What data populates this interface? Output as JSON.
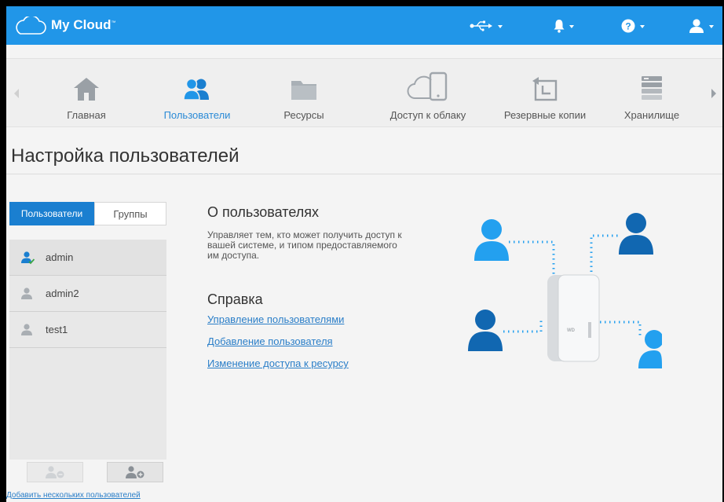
{
  "app": {
    "title": "My Cloud",
    "trademark": "™"
  },
  "colors": {
    "topbar": "#2196e8",
    "accent": "#1a7fd0",
    "link": "#2a7ec8",
    "person_dark": "#1167b1",
    "person_light": "#23a0ef"
  },
  "topbar": {
    "icons": [
      "usb-icon",
      "bell-icon",
      "help-icon",
      "user-icon"
    ]
  },
  "nav": {
    "items": [
      {
        "label": "Главная",
        "icon": "home-icon"
      },
      {
        "label": "Пользователи",
        "icon": "users-icon",
        "active": true
      },
      {
        "label": "Ресурсы",
        "icon": "folder-icon"
      },
      {
        "label": "Доступ к облаку",
        "icon": "cloud-mobile-icon"
      },
      {
        "label": "Резервные копии",
        "icon": "backup-icon"
      },
      {
        "label": "Хранилище",
        "icon": "storage-icon"
      }
    ]
  },
  "page": {
    "title": "Настройка пользователей"
  },
  "left": {
    "tabs": {
      "users": "Пользователи",
      "groups": "Группы"
    },
    "users": [
      {
        "name": "admin",
        "admin": true
      },
      {
        "name": "admin2"
      },
      {
        "name": "test1"
      }
    ],
    "add_multiple": "Добавить нескольких пользователей"
  },
  "main": {
    "about_title": "О пользователях",
    "about_text": "Управляет тем, кто может получить доступ к вашей системе, и типом предоставляемого им доступа.",
    "help_title": "Справка",
    "links": [
      "Управление пользователями",
      "Добавление пользователя",
      "Изменение доступа к ресурсу"
    ]
  }
}
